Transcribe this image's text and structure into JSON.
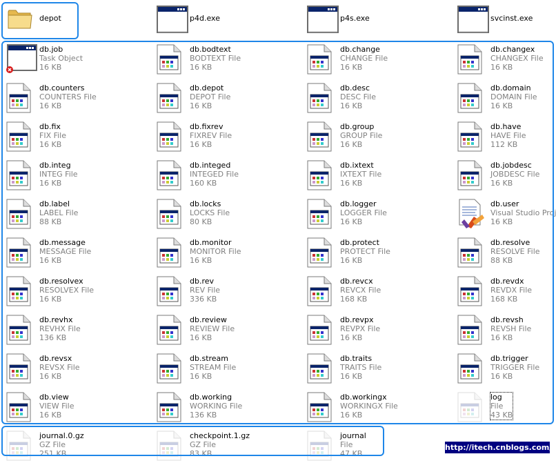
{
  "rows": [
    [
      {
        "name": "depot",
        "icon": "folder-icon"
      },
      {
        "name": "p4d.exe",
        "icon": "exe-window-icon"
      },
      {
        "name": "p4s.exe",
        "icon": "exe-window-icon"
      },
      {
        "name": "svcinst.exe",
        "icon": "exe-window-icon"
      }
    ],
    [
      {
        "name": "db.job",
        "type": "Task Object",
        "size": "16 KB",
        "icon": "task-window-error-icon"
      },
      {
        "name": "db.bodtext",
        "type": "BODTEXT File",
        "size": "16 KB",
        "icon": "app-file-icon"
      },
      {
        "name": "db.change",
        "type": "CHANGE File",
        "size": "16 KB",
        "icon": "app-file-icon"
      },
      {
        "name": "db.changex",
        "type": "CHANGEX File",
        "size": "16 KB",
        "icon": "app-file-icon"
      }
    ],
    [
      {
        "name": "db.counters",
        "type": "COUNTERS File",
        "size": "16 KB",
        "icon": "app-file-icon"
      },
      {
        "name": "db.depot",
        "type": "DEPOT File",
        "size": "16 KB",
        "icon": "app-file-icon"
      },
      {
        "name": "db.desc",
        "type": "DESC File",
        "size": "16 KB",
        "icon": "app-file-icon"
      },
      {
        "name": "db.domain",
        "type": "DOMAIN File",
        "size": "16 KB",
        "icon": "app-file-icon"
      }
    ],
    [
      {
        "name": "db.fix",
        "type": "FIX File",
        "size": "16 KB",
        "icon": "app-file-icon"
      },
      {
        "name": "db.fixrev",
        "type": "FIXREV File",
        "size": "16 KB",
        "icon": "app-file-icon"
      },
      {
        "name": "db.group",
        "type": "GROUP File",
        "size": "16 KB",
        "icon": "app-file-icon"
      },
      {
        "name": "db.have",
        "type": "HAVE File",
        "size": "112 KB",
        "icon": "app-file-icon"
      }
    ],
    [
      {
        "name": "db.integ",
        "type": "INTEG File",
        "size": "16 KB",
        "icon": "app-file-icon"
      },
      {
        "name": "db.integed",
        "type": "INTEGED File",
        "size": "160 KB",
        "icon": "app-file-icon"
      },
      {
        "name": "db.ixtext",
        "type": "IXTEXT File",
        "size": "16 KB",
        "icon": "app-file-icon"
      },
      {
        "name": "db.jobdesc",
        "type": "JOBDESC File",
        "size": "16 KB",
        "icon": "app-file-icon"
      }
    ],
    [
      {
        "name": "db.label",
        "type": "LABEL File",
        "size": "88 KB",
        "icon": "app-file-icon"
      },
      {
        "name": "db.locks",
        "type": "LOCKS File",
        "size": "80 KB",
        "icon": "app-file-icon"
      },
      {
        "name": "db.logger",
        "type": "LOGGER File",
        "size": "16 KB",
        "icon": "app-file-icon"
      },
      {
        "name": "db.user",
        "type": "Visual Studio Project",
        "size": "16 KB",
        "icon": "visual-studio-project-icon"
      }
    ],
    [
      {
        "name": "db.message",
        "type": "MESSAGE File",
        "size": "16 KB",
        "icon": "app-file-icon"
      },
      {
        "name": "db.monitor",
        "type": "MONITOR File",
        "size": "16 KB",
        "icon": "app-file-icon"
      },
      {
        "name": "db.protect",
        "type": "PROTECT File",
        "size": "16 KB",
        "icon": "app-file-icon"
      },
      {
        "name": "db.resolve",
        "type": "RESOLVE File",
        "size": "88 KB",
        "icon": "app-file-icon"
      }
    ],
    [
      {
        "name": "db.resolvex",
        "type": "RESOLVEX File",
        "size": "16 KB",
        "icon": "app-file-icon"
      },
      {
        "name": "db.rev",
        "type": "REV File",
        "size": "336 KB",
        "icon": "app-file-icon"
      },
      {
        "name": "db.revcx",
        "type": "REVCX File",
        "size": "168 KB",
        "icon": "app-file-icon"
      },
      {
        "name": "db.revdx",
        "type": "REVDX File",
        "size": "168 KB",
        "icon": "app-file-icon"
      }
    ],
    [
      {
        "name": "db.revhx",
        "type": "REVHX File",
        "size": "136 KB",
        "icon": "app-file-icon"
      },
      {
        "name": "db.review",
        "type": "REVIEW File",
        "size": "16 KB",
        "icon": "app-file-icon"
      },
      {
        "name": "db.revpx",
        "type": "REVPX File",
        "size": "16 KB",
        "icon": "app-file-icon"
      },
      {
        "name": "db.revsh",
        "type": "REVSH File",
        "size": "16 KB",
        "icon": "app-file-icon"
      }
    ],
    [
      {
        "name": "db.revsx",
        "type": "REVSX File",
        "size": "16 KB",
        "icon": "app-file-icon"
      },
      {
        "name": "db.stream",
        "type": "STREAM File",
        "size": "16 KB",
        "icon": "app-file-icon"
      },
      {
        "name": "db.traits",
        "type": "TRAITS File",
        "size": "16 KB",
        "icon": "app-file-icon"
      },
      {
        "name": "db.trigger",
        "type": "TRIGGER File",
        "size": "16 KB",
        "icon": "app-file-icon"
      }
    ],
    [
      {
        "name": "db.view",
        "type": "VIEW File",
        "size": "16 KB",
        "icon": "app-file-icon"
      },
      {
        "name": "db.working",
        "type": "WORKING File",
        "size": "136 KB",
        "icon": "app-file-icon"
      },
      {
        "name": "db.workingx",
        "type": "WORKINGX File",
        "size": "16 KB",
        "icon": "app-file-icon"
      },
      {
        "name": "log",
        "type": "File",
        "size": "43 KB",
        "icon": "app-file-faded-icon"
      }
    ],
    [
      {
        "name": "journal.0.gz",
        "type": "GZ File",
        "size": "251 KB",
        "icon": "app-file-faded-icon"
      },
      {
        "name": "checkpoint.1.gz",
        "type": "GZ File",
        "size": "83 KB",
        "icon": "app-file-faded-icon"
      },
      {
        "name": "journal",
        "type": "File",
        "size": "47 KB",
        "icon": "app-file-faded-icon"
      }
    ]
  ],
  "watermark": "http://itech.cnblogs.com/",
  "colors": {
    "selection_border": "#1e86e8",
    "titlebar": "#0a246a",
    "folder": "#f4d58d",
    "watermark_bg": "#000080"
  }
}
